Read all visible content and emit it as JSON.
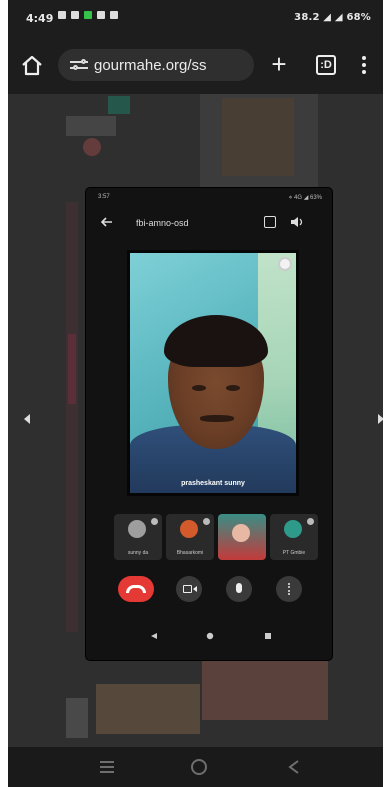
{
  "status_bar": {
    "time": "4:49",
    "right_text": "38.2 ◢ ◢ 68%"
  },
  "browser": {
    "url": "gourmahe.org/ss",
    "tab_count": ":D"
  },
  "call": {
    "status_time": "3:57",
    "status_right": "⋄ 4G ◢ 63%",
    "meeting_code": "fbi-amno-osd",
    "speaker_name": "prasheskant sunny",
    "participants": [
      {
        "label": "sunny da"
      },
      {
        "label": "Bhasarkomi"
      },
      {
        "label": ""
      },
      {
        "label": "PT Gmbie"
      }
    ]
  },
  "colors": {
    "end_call": "#e53935",
    "status_green": "#37c24a",
    "video_bg": "#5eb9c2"
  },
  "icons": [
    "home-icon",
    "tune-icon",
    "plus-icon",
    "tabs-icon",
    "overflow-menu-icon",
    "back-arrow-icon",
    "end-call-icon",
    "camera-icon",
    "mic-icon",
    "more-icon",
    "recents-icon",
    "home-circle-icon",
    "back-triangle-icon"
  ]
}
